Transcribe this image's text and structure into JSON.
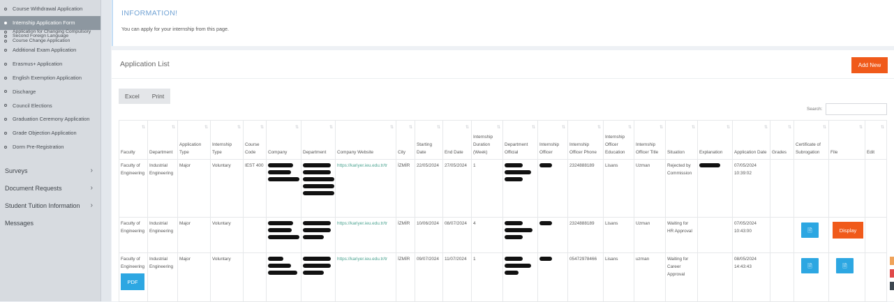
{
  "sidebar": {
    "items": [
      {
        "label": "Course Withdrawal Application",
        "active": false
      },
      {
        "label": "Internship Application Form",
        "active": true
      },
      {
        "label": "Application for Changing Compulsory",
        "active": false,
        "tight": true
      },
      {
        "label": "Second Foreign Language",
        "active": false,
        "tight": true
      },
      {
        "label": "Course Change Application",
        "active": false,
        "tight": true
      },
      {
        "label": "Additional Exam Application",
        "active": false
      },
      {
        "label": "Erasmus+ Application",
        "active": false
      },
      {
        "label": "English Exemption Application",
        "active": false
      },
      {
        "label": "Discharge",
        "active": false
      },
      {
        "label": "Council Elections",
        "active": false
      },
      {
        "label": "Graduation Ceremony Application",
        "active": false
      },
      {
        "label": "Grade Objection Application",
        "active": false
      },
      {
        "label": "Dorm Pre-Registration",
        "active": false
      }
    ],
    "main": [
      {
        "label": "Surveys",
        "arrow": "›"
      },
      {
        "label": "Document Requests",
        "arrow": "›"
      },
      {
        "label": "Student Tuition Information",
        "arrow": "›"
      },
      {
        "label": "Messages",
        "arrow": ""
      }
    ]
  },
  "info": {
    "title": "INFORMATION!",
    "text": "You can apply for your internship from this page."
  },
  "panel": {
    "title": "Application List",
    "add_new": "Add New",
    "excel": "Excel",
    "print": "Print",
    "search_label": "Search:"
  },
  "table": {
    "headers": [
      "Faculty",
      "Department",
      "Application Type",
      "Internship Type",
      "Course Code",
      "Company",
      "Department",
      "Company Website",
      "City",
      "Starting Date",
      "End Date",
      "Internship Duration (Week)",
      "Department Official",
      "Internship Officer",
      "Internship Officer Phone",
      "Internship Officer Education",
      "Internship Officer Title",
      "Situation",
      "Explanation",
      "Application Date",
      "Grades",
      "Certificate of Subrogation",
      "File",
      "Edit"
    ],
    "rows": [
      {
        "faculty": "Faculty of Engineering",
        "department": "Industrial Engineering",
        "app_type": "Major",
        "int_type": "Voluntary",
        "course_code": "IEST 400",
        "website": "https://kariyer.ieu.edu.tr/tr",
        "city": "İZMİR",
        "start": "22/05/2024",
        "end": "27/05/2024",
        "duration": "1",
        "phone": "2324888189",
        "education": "Lisans",
        "title": "Uzman",
        "situation": "Rejected by Commission",
        "app_date": "07/05/2024 10:39:02"
      },
      {
        "faculty": "Faculty of Engineering",
        "department": "Industrial Engineering",
        "app_type": "Major",
        "int_type": "Voluntary",
        "course_code": "",
        "website": "https://kariyer.ieu.edu.tr/tr",
        "city": "İZMİR",
        "start": "10/06/2024",
        "end": "08/07/2024",
        "duration": "4",
        "phone": "2324888189",
        "education": "Lisans",
        "title": "Uzman",
        "situation": "Waiting for HR Approval",
        "app_date": "07/05/2024 10:43:00",
        "display": "Display"
      },
      {
        "faculty": "Faculty of Engineering",
        "department": "Industrial Engineering",
        "app_type": "Major",
        "int_type": "Voluntary",
        "course_code": "",
        "website": "https://kariyer.ieu.edu.tr/tr",
        "city": "İZMİR",
        "start": "09/07/2024",
        "end": "11/07/2024",
        "duration": "1",
        "phone": "05472978466",
        "education": "Lisans",
        "title": "uzman",
        "situation": "Waiting for Career Approval",
        "app_date": "08/05/2024 14:43:43",
        "pdf": "PDF"
      }
    ]
  },
  "colors": {
    "accent": "#f05a1a",
    "blue": "#2da7e2",
    "link": "#49a28f"
  }
}
